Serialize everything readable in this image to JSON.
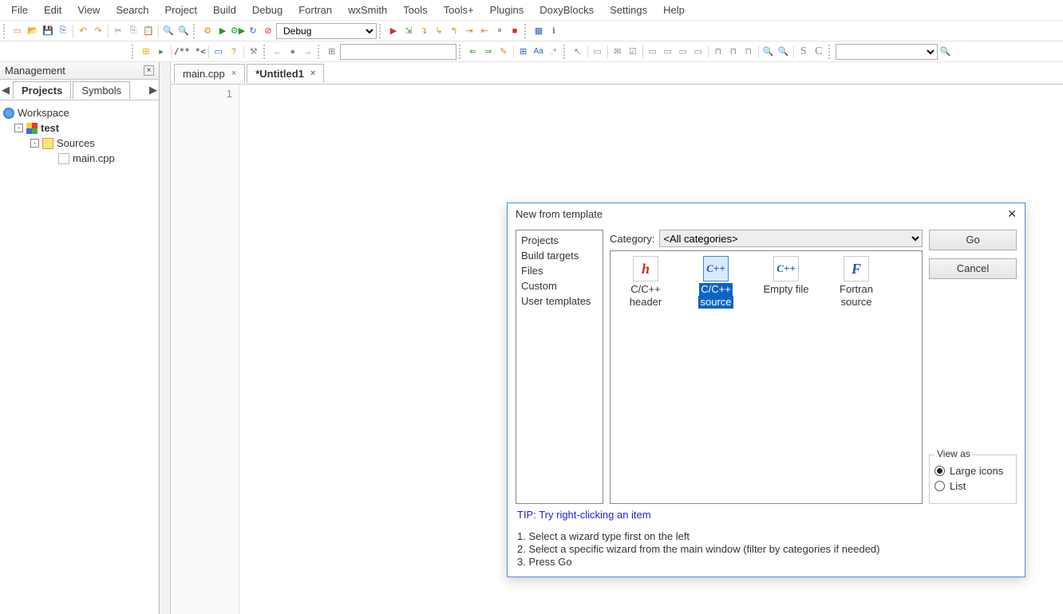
{
  "menu": {
    "items": [
      "File",
      "Edit",
      "View",
      "Search",
      "Project",
      "Build",
      "Debug",
      "Fortran",
      "wxSmith",
      "Tools",
      "Tools+",
      "Plugins",
      "DoxyBlocks",
      "Settings",
      "Help"
    ]
  },
  "toolbar": {
    "build_target": "Debug",
    "comment_box": "/**  *<"
  },
  "management": {
    "title": "Management",
    "tabs": {
      "active": "Projects",
      "other": "Symbols"
    },
    "tree": {
      "workspace": "Workspace",
      "project": "test",
      "sources_folder": "Sources",
      "file": "main.cpp"
    }
  },
  "editor": {
    "tabs": [
      {
        "label": "main.cpp",
        "active": false
      },
      {
        "label": "*Untitled1",
        "active": true
      }
    ],
    "line_number": "1"
  },
  "dialog": {
    "title": "New from template",
    "left_list": [
      "Projects",
      "Build targets",
      "Files",
      "Custom",
      "User templates"
    ],
    "category_label": "Category:",
    "category_value": "<All categories>",
    "templates": [
      {
        "label1": "C/C++",
        "label2": "header",
        "glyph": "h",
        "color": "#c03020",
        "selected": false
      },
      {
        "label1": "C/C++",
        "label2": "source",
        "glyph": "C++",
        "color": "#2050c0",
        "selected": true
      },
      {
        "label1": "Empty file",
        "label2": "",
        "glyph": "C++",
        "color": "#2050c0",
        "selected": false
      },
      {
        "label1": "Fortran",
        "label2": "source",
        "glyph": "F",
        "color": "#2050c0",
        "selected": false
      }
    ],
    "go_btn": "Go",
    "cancel_btn": "Cancel",
    "view_as": {
      "legend": "View as",
      "large": "Large icons",
      "list": "List",
      "selected": "large"
    },
    "tip": "TIP: Try right-clicking an item",
    "steps": [
      "1. Select a wizard type first on the left",
      "2. Select a specific wizard from the main window (filter by categories if needed)",
      "3. Press Go"
    ]
  }
}
